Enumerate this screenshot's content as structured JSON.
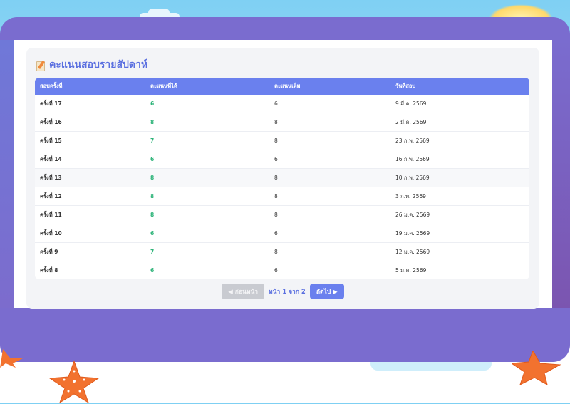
{
  "card": {
    "title": "คะแนนสอบรายสัปดาห์"
  },
  "table": {
    "headers": [
      "สอบครั้งที่",
      "คะแนนที่ได้",
      "คะแนนเต็ม",
      "วันที่สอบ"
    ],
    "rows": [
      {
        "round": "ครั้งที่ 17",
        "score": "6",
        "full": "6",
        "date": "9 มี.ค. 2569"
      },
      {
        "round": "ครั้งที่ 16",
        "score": "8",
        "full": "8",
        "date": "2 มี.ค. 2569"
      },
      {
        "round": "ครั้งที่ 15",
        "score": "7",
        "full": "8",
        "date": "23 ก.พ. 2569"
      },
      {
        "round": "ครั้งที่ 14",
        "score": "6",
        "full": "6",
        "date": "16 ก.พ. 2569"
      },
      {
        "round": "ครั้งที่ 13",
        "score": "8",
        "full": "8",
        "date": "10 ก.พ. 2569"
      },
      {
        "round": "ครั้งที่ 12",
        "score": "8",
        "full": "8",
        "date": "3 ก.พ. 2569"
      },
      {
        "round": "ครั้งที่ 11",
        "score": "8",
        "full": "8",
        "date": "26 ม.ค. 2569"
      },
      {
        "round": "ครั้งที่ 10",
        "score": "6",
        "full": "6",
        "date": "19 ม.ค. 2569"
      },
      {
        "round": "ครั้งที่ 9",
        "score": "7",
        "full": "8",
        "date": "12 ม.ค. 2569"
      },
      {
        "round": "ครั้งที่ 8",
        "score": "6",
        "full": "6",
        "date": "5 ม.ค. 2569"
      }
    ]
  },
  "pagination": {
    "prev_label": "◀ ก่อนหน้า",
    "page_info": "หน้า 1 จาก 2",
    "next_label": "ถัดไป ▶"
  },
  "colors": {
    "accent": "#6a80ee",
    "frame": "#7a6ccf",
    "score_green": "#2fb47a"
  },
  "icons": {
    "title_icon": "memo-pencil-icon",
    "decor": "starfish-icon"
  }
}
